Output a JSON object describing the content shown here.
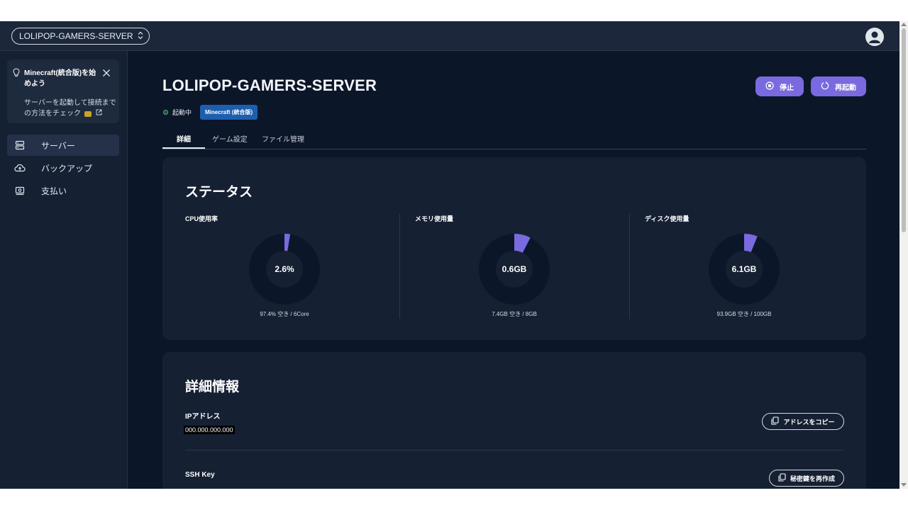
{
  "header": {
    "server_name": "LOLIPOP-GAMERS-SERVER"
  },
  "sidebar": {
    "tip": {
      "title": "Minecraft(統合版)を始めよう",
      "body": "サーバーを起動して接続までの方法をチェック"
    },
    "items": [
      {
        "label": "サーバー",
        "icon": "server-icon",
        "active": true
      },
      {
        "label": "バックアップ",
        "icon": "cloud-upload-icon",
        "active": false
      },
      {
        "label": "支払い",
        "icon": "payment-icon",
        "active": false
      }
    ]
  },
  "main": {
    "title": "LOLIPOP-GAMERS-SERVER",
    "status_text": "起動中",
    "game_badge": "Minecraft (統合版)",
    "buttons": {
      "stop": "停止",
      "restart": "再起動"
    },
    "tabs": [
      {
        "label": "詳細",
        "active": true
      },
      {
        "label": "ゲーム設定",
        "active": false
      },
      {
        "label": "ファイル管理",
        "active": false
      }
    ]
  },
  "status_card": {
    "title": "ステータス",
    "metrics": [
      {
        "label": "CPU使用率",
        "value": "2.6%",
        "fraction": 0.026,
        "sub": "97.4% 空き / 6Core"
      },
      {
        "label": "メモリ使用量",
        "value": "0.6GB",
        "fraction": 0.075,
        "sub": "7.4GB 空き / 8GB"
      },
      {
        "label": "ディスク使用量",
        "value": "6.1GB",
        "fraction": 0.061,
        "sub": "93.9GB 空き / 100GB"
      }
    ]
  },
  "details_card": {
    "title": "詳細情報",
    "ip_label": "IPアドレス",
    "ip_value": "000.000.000.000",
    "copy_button": "アドレスをコピー",
    "ssh_label": "SSH Key",
    "regenerate_button": "秘密鍵を再作成"
  },
  "colors": {
    "accent": "#7a6ae0",
    "background": "#0c1629",
    "card": "#162033",
    "badge": "#1d5fae",
    "donut_track": "#0c1629",
    "status_running": "#4caf76"
  }
}
